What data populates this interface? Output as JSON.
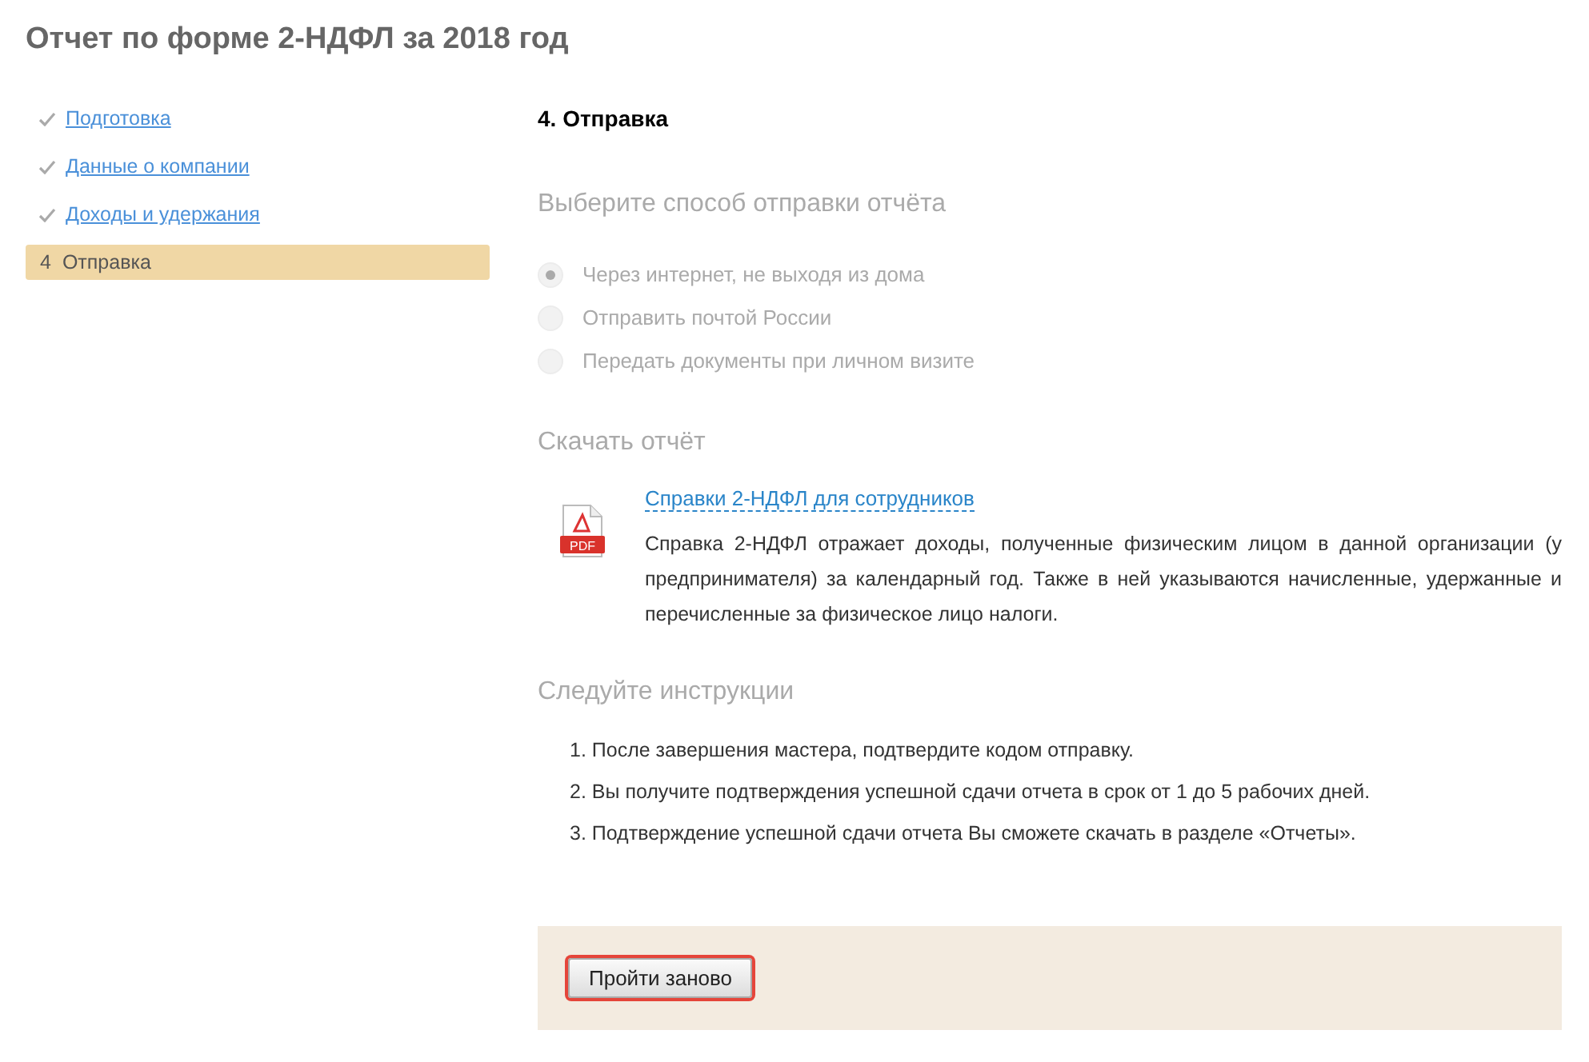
{
  "page": {
    "title": "Отчет по форме 2-НДФЛ за 2018 год"
  },
  "steps": [
    {
      "label": "Подготовка",
      "done": true,
      "selected": false
    },
    {
      "label": "Данные о компании",
      "done": true,
      "selected": false
    },
    {
      "label": "Доходы и удержания",
      "done": true,
      "selected": false
    },
    {
      "number": "4",
      "label": "Отправка",
      "done": false,
      "selected": true
    }
  ],
  "content": {
    "heading": "4. Отправка",
    "send_method": {
      "heading": "Выберите способ отправки отчёта",
      "disabled": true,
      "options": [
        {
          "label": "Через интернет, не выходя из дома",
          "selected": true
        },
        {
          "label": "Отправить почтой России",
          "selected": false
        },
        {
          "label": "Передать документы при личном визите",
          "selected": false
        }
      ]
    },
    "download": {
      "heading": "Скачать отчёт",
      "file_type": "PDF",
      "link": "Справки 2-НДФЛ для сотрудников",
      "description": "Справка 2-НДФЛ отражает доходы, полученные физическим лицом в данной организации (у предпринимателя) за календарный год. Также в ней указываются начисленные, удержанные и перечисленные за физическое лицо налоги."
    },
    "instructions": {
      "heading": "Следуйте инструкции",
      "items": [
        "1. После завершения мастера, подтвердите кодом отправку.",
        "2. Вы получите подтверждения успешной сдачи отчета в срок от 1 до 5 рабочих дней.",
        "3. Подтверждение успешной сдачи отчета Вы сможете скачать в разделе «Отчеты»."
      ]
    },
    "restart_button": {
      "label": "Пройти заново",
      "focused": true
    }
  }
}
